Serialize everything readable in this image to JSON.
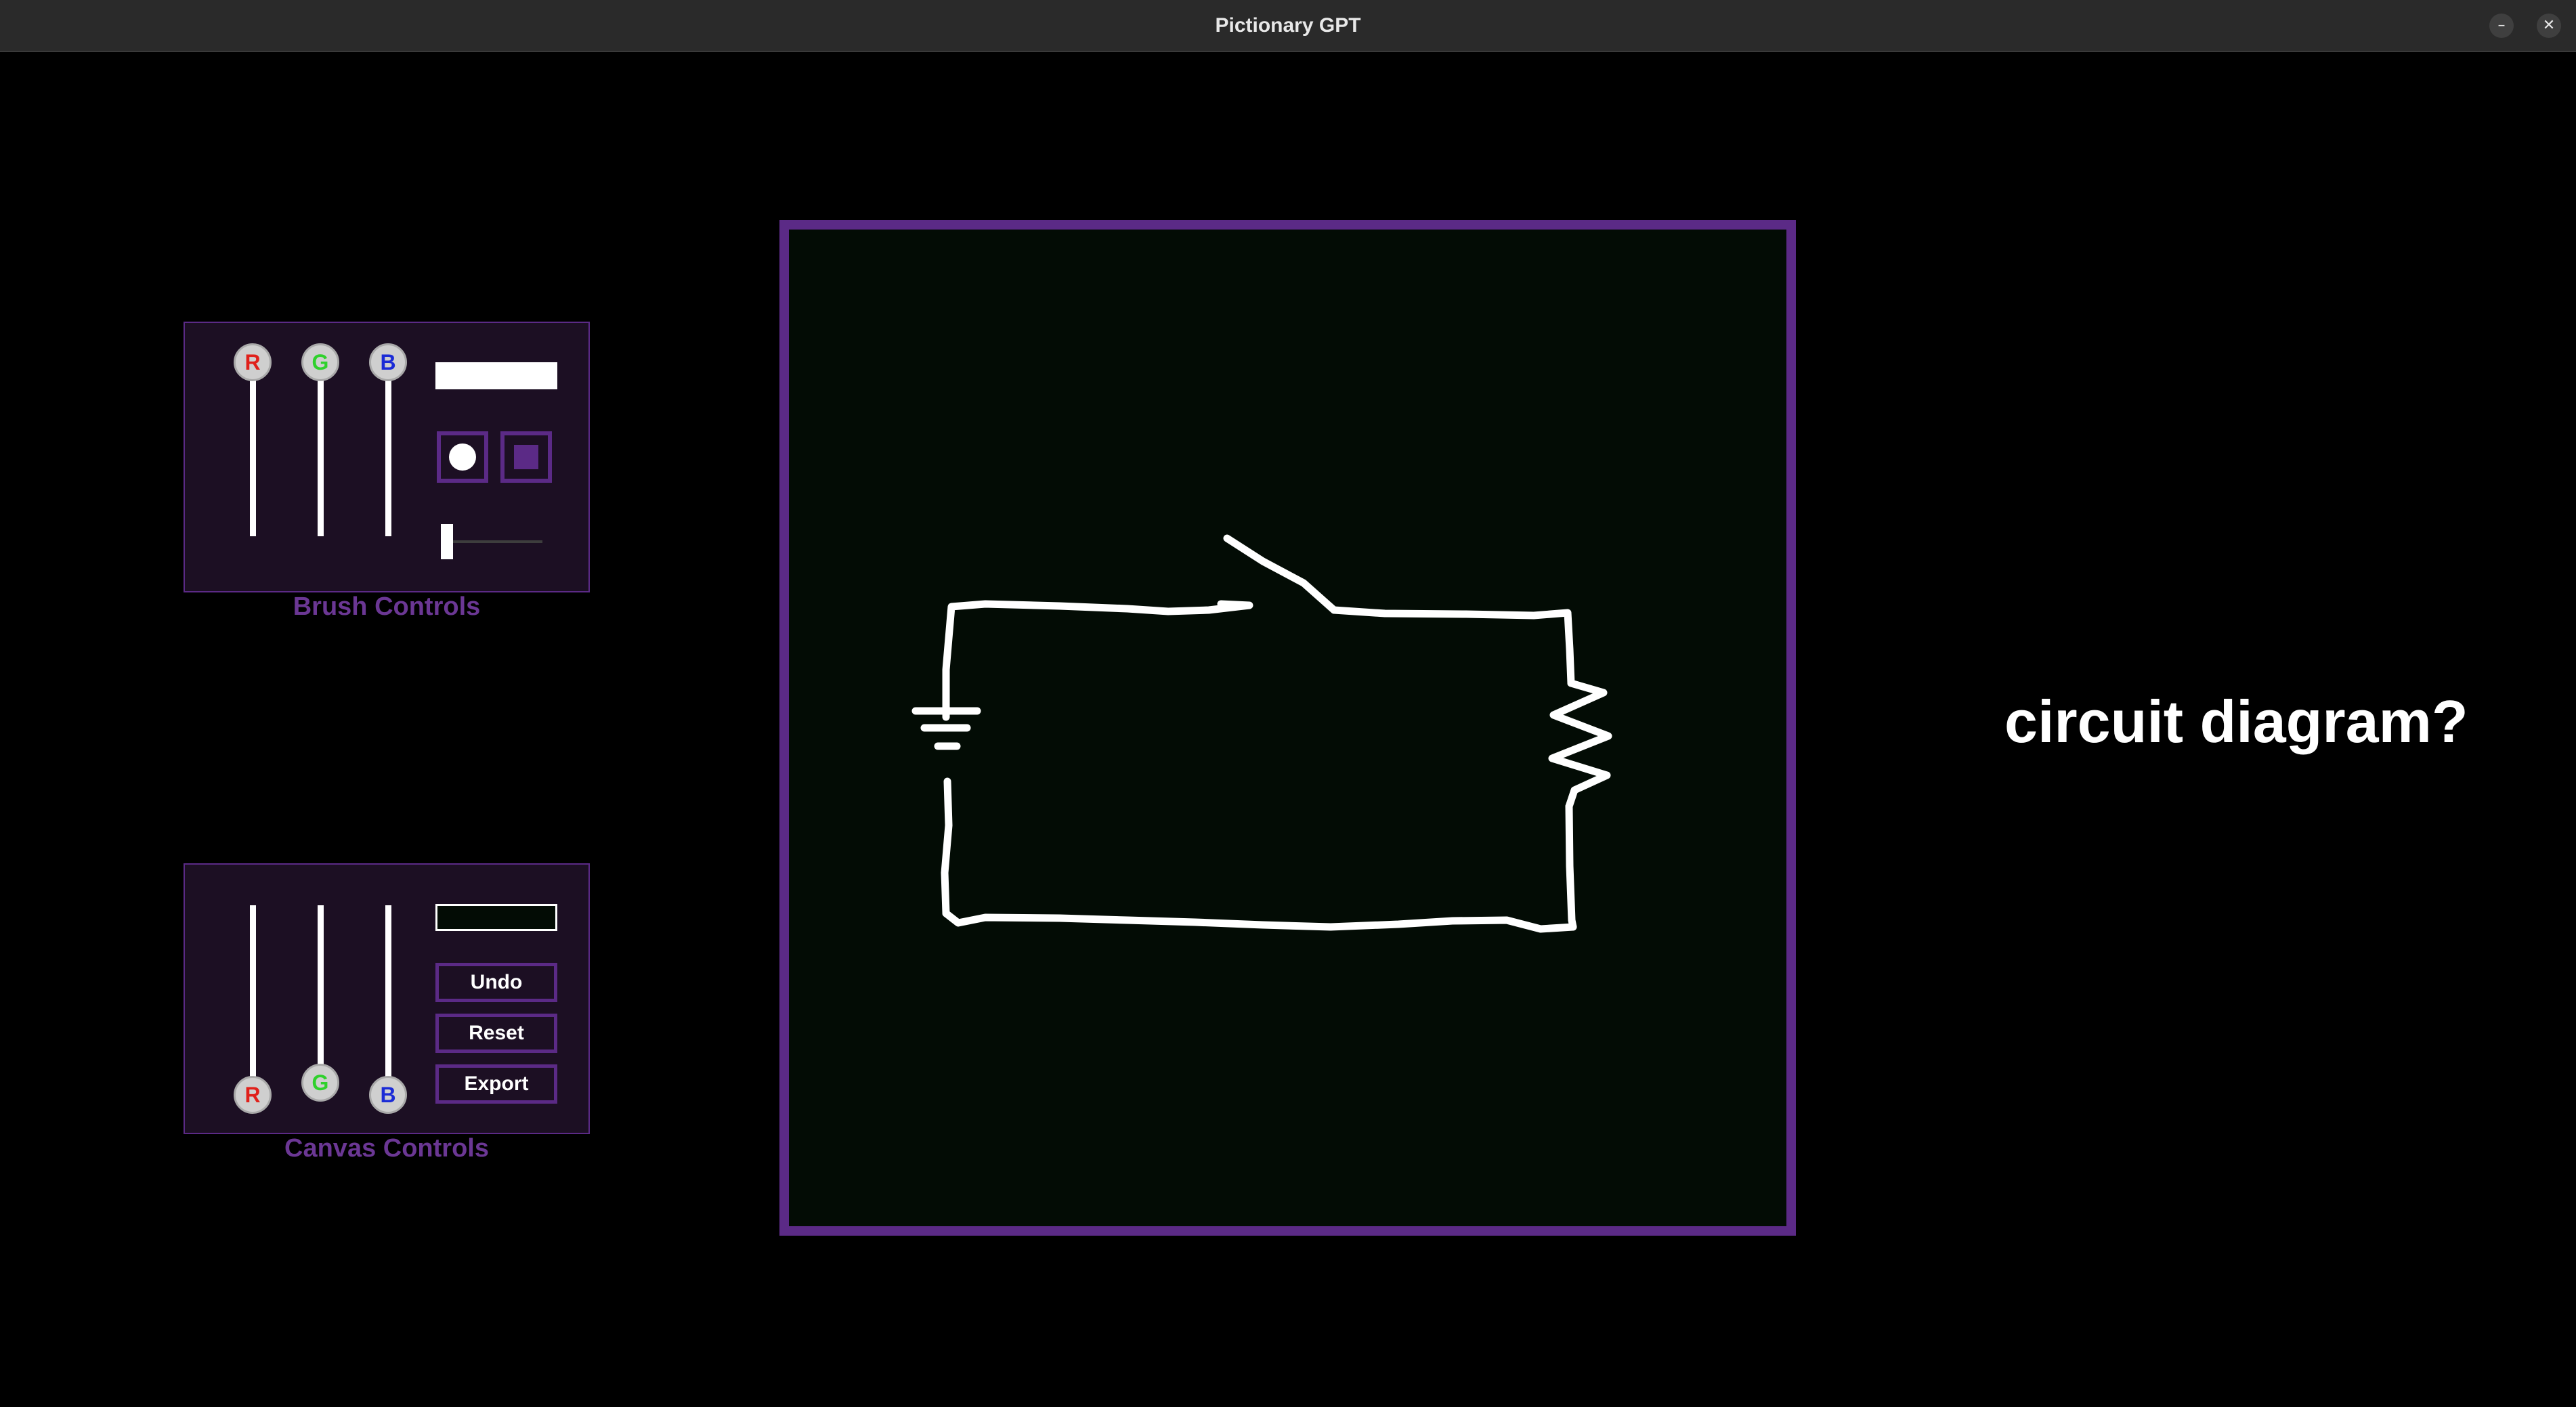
{
  "window": {
    "title": "Pictionary GPT",
    "minimize_icon": "–",
    "close_icon": "✕"
  },
  "brush_controls": {
    "label": "Brush Controls",
    "sliders": [
      {
        "channel": "R",
        "value": 255,
        "color": "#e0201b"
      },
      {
        "channel": "G",
        "value": 255,
        "color": "#2fd12c"
      },
      {
        "channel": "B",
        "value": 255,
        "color": "#1b2bd6"
      }
    ],
    "color_preview": "#ffffff",
    "shapes": [
      "circle",
      "square"
    ],
    "selected_shape": "circle",
    "size_fraction": 0.05
  },
  "canvas_controls": {
    "label": "Canvas Controls",
    "sliders": [
      {
        "channel": "R",
        "value": 3,
        "color": "#e0201b"
      },
      {
        "channel": "G",
        "value": 12,
        "color": "#2fd12c"
      },
      {
        "channel": "B",
        "value": 5,
        "color": "#1b2bd6"
      }
    ],
    "color_preview": "#030c05",
    "buttons": {
      "undo": "Undo",
      "reset": "Reset",
      "export": "Export"
    }
  },
  "canvas": {
    "background": "#030c05",
    "border_color": "#5b2a86",
    "stroke_color": "#ffffff"
  },
  "guess": {
    "text": "circuit diagram?"
  },
  "colors": {
    "accent": "#5b2a86",
    "panel_bg": "#1c0f23",
    "label": "#6b3794"
  }
}
